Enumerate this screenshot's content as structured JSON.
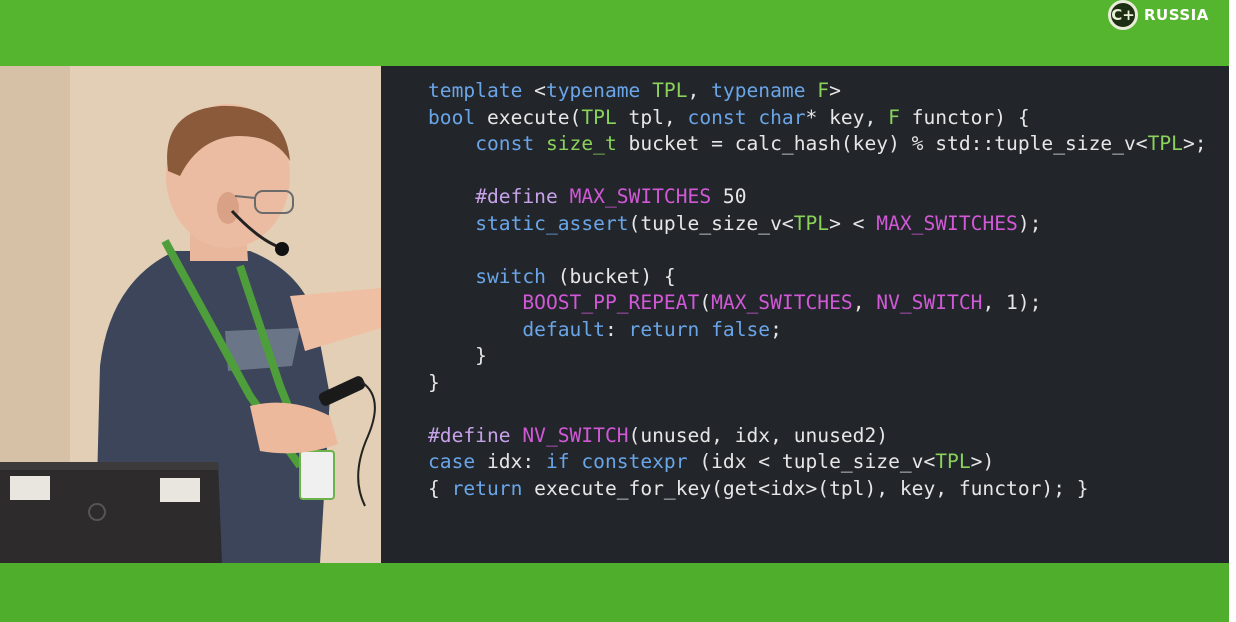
{
  "branding": {
    "logo_text": "RUSSIA",
    "logo_mark": "C+"
  },
  "video": {
    "laptop_sticker_1": "",
    "laptop_sticker_2": ""
  },
  "slide": {
    "code_lines": [
      [
        {
          "t": "template",
          "c": "kw"
        },
        {
          "t": " <",
          "c": "tx"
        },
        {
          "t": "typename",
          "c": "kw"
        },
        {
          "t": " ",
          "c": "tx"
        },
        {
          "t": "TPL",
          "c": "ty"
        },
        {
          "t": ", ",
          "c": "tx"
        },
        {
          "t": "typename",
          "c": "kw"
        },
        {
          "t": " ",
          "c": "tx"
        },
        {
          "t": "F",
          "c": "ty"
        },
        {
          "t": ">",
          "c": "tx"
        }
      ],
      [
        {
          "t": "bool",
          "c": "kw"
        },
        {
          "t": " execute(",
          "c": "tx"
        },
        {
          "t": "TPL",
          "c": "ty"
        },
        {
          "t": " tpl, ",
          "c": "tx"
        },
        {
          "t": "const",
          "c": "kw"
        },
        {
          "t": " ",
          "c": "tx"
        },
        {
          "t": "char",
          "c": "kw"
        },
        {
          "t": "* key, ",
          "c": "tx"
        },
        {
          "t": "F",
          "c": "ty"
        },
        {
          "t": " functor) {",
          "c": "tx"
        }
      ],
      [
        {
          "t": "    ",
          "c": "tx"
        },
        {
          "t": "const",
          "c": "kw"
        },
        {
          "t": " ",
          "c": "tx"
        },
        {
          "t": "size_t",
          "c": "ty"
        },
        {
          "t": " bucket = calc_hash(key) % std::tuple_size_v<",
          "c": "tx"
        },
        {
          "t": "TPL",
          "c": "ty"
        },
        {
          "t": ">;",
          "c": "tx"
        }
      ],
      [],
      [
        {
          "t": "    ",
          "c": "tx"
        },
        {
          "t": "#define",
          "c": "pp"
        },
        {
          "t": " ",
          "c": "tx"
        },
        {
          "t": "MAX_SWITCHES",
          "c": "mc"
        },
        {
          "t": " 50",
          "c": "tx"
        }
      ],
      [
        {
          "t": "    ",
          "c": "tx"
        },
        {
          "t": "static_assert",
          "c": "kw"
        },
        {
          "t": "(tuple_size_v<",
          "c": "tx"
        },
        {
          "t": "TPL",
          "c": "ty"
        },
        {
          "t": "> < ",
          "c": "tx"
        },
        {
          "t": "MAX_SWITCHES",
          "c": "mc"
        },
        {
          "t": ");",
          "c": "tx"
        }
      ],
      [],
      [
        {
          "t": "    ",
          "c": "tx"
        },
        {
          "t": "switch",
          "c": "kw"
        },
        {
          "t": " (bucket) {",
          "c": "tx"
        }
      ],
      [
        {
          "t": "        ",
          "c": "tx"
        },
        {
          "t": "BOOST_PP_REPEAT",
          "c": "mc"
        },
        {
          "t": "(",
          "c": "tx"
        },
        {
          "t": "MAX_SWITCHES",
          "c": "mc"
        },
        {
          "t": ", ",
          "c": "tx"
        },
        {
          "t": "NV_SWITCH",
          "c": "mc"
        },
        {
          "t": ", 1);",
          "c": "tx"
        }
      ],
      [
        {
          "t": "        ",
          "c": "tx"
        },
        {
          "t": "default",
          "c": "kw"
        },
        {
          "t": ": ",
          "c": "tx"
        },
        {
          "t": "return",
          "c": "kw"
        },
        {
          "t": " ",
          "c": "tx"
        },
        {
          "t": "false",
          "c": "kw"
        },
        {
          "t": ";",
          "c": "tx"
        }
      ],
      [
        {
          "t": "    }",
          "c": "tx"
        }
      ],
      [
        {
          "t": "}",
          "c": "tx"
        }
      ],
      [],
      [
        {
          "t": "#define",
          "c": "pp"
        },
        {
          "t": " ",
          "c": "tx"
        },
        {
          "t": "NV_SWITCH",
          "c": "mc"
        },
        {
          "t": "(unused, idx, unused2)",
          "c": "tx"
        }
      ],
      [
        {
          "t": "case",
          "c": "kw"
        },
        {
          "t": " idx: ",
          "c": "tx"
        },
        {
          "t": "if",
          "c": "kw"
        },
        {
          "t": " ",
          "c": "tx"
        },
        {
          "t": "constexpr",
          "c": "kw"
        },
        {
          "t": " (idx < tuple_size_v<",
          "c": "tx"
        },
        {
          "t": "TPL",
          "c": "ty"
        },
        {
          "t": ">)",
          "c": "tx"
        }
      ],
      [
        {
          "t": "{ ",
          "c": "tx"
        },
        {
          "t": "return",
          "c": "kw"
        },
        {
          "t": " execute_for_key(get<idx>(tpl), key, functor); }",
          "c": "tx"
        }
      ]
    ]
  },
  "colors": {
    "band_green": "#55b52f",
    "slide_bg": "#22262b",
    "keyword": "#6aa5e8",
    "type": "#8ad25a",
    "macro": "#d158d6",
    "preprocessor": "#c7a2ea",
    "text": "#e6e6e6"
  },
  "icons": {
    "logo": "cpp-russia-logo-icon",
    "laptop_brand": "hp-logo-icon"
  }
}
